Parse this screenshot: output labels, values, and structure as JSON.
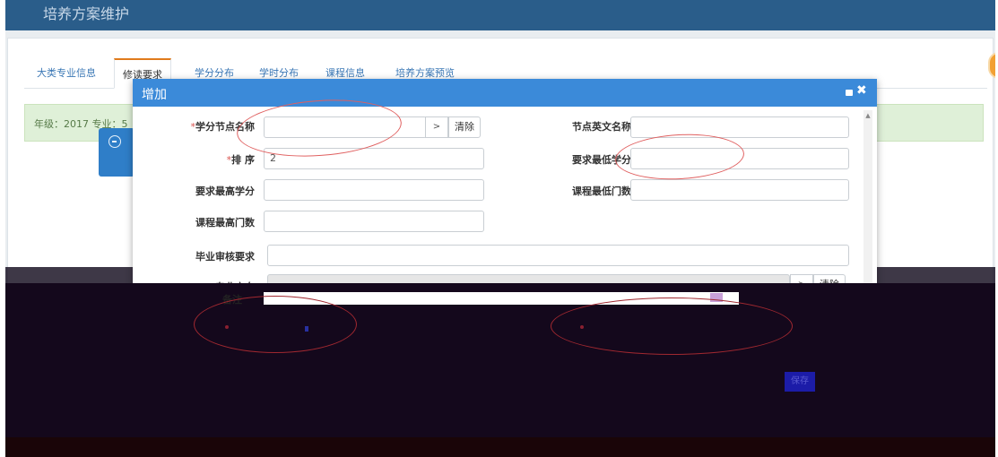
{
  "page": {
    "title": "培养方案维护"
  },
  "tabs": [
    {
      "label": "大类专业信息",
      "active": false
    },
    {
      "label": "修读要求",
      "active": true
    },
    {
      "label": "学分分布",
      "active": false
    },
    {
      "label": "学时分布",
      "active": false
    },
    {
      "label": "课程信息",
      "active": false
    },
    {
      "label": "培养方案预览",
      "active": false
    }
  ],
  "info_bar": {
    "text": "年级：2017 专业：5"
  },
  "modal": {
    "title": "增加",
    "fields": {
      "credit_node_name": {
        "label": "学分节点名称",
        "required": true,
        "value": "",
        "pick_button": ">",
        "clear_button": "清除"
      },
      "node_english_name": {
        "label": "节点英文名称",
        "value": ""
      },
      "order": {
        "label": "排 序",
        "required": true,
        "value": "2"
      },
      "min_credit": {
        "label": "要求最低学分",
        "value": ""
      },
      "max_credit": {
        "label": "要求最高学分",
        "value": ""
      },
      "min_courses": {
        "label": "课程最低门数",
        "value": ""
      },
      "max_courses": {
        "label": "课程最高门数",
        "value": ""
      },
      "graduation_review": {
        "label": "毕业审核要求",
        "value": ""
      },
      "major_direction": {
        "label": "专业方向",
        "value": "",
        "pick_button": ">",
        "clear_button": "清除"
      },
      "remarks": {
        "label": "备注"
      }
    }
  },
  "hidden_footer": {
    "save_button": "保存"
  },
  "colors": {
    "header_blue": "#3b8ad9",
    "top_bar": "#2a5d8a",
    "active_tab_accent": "#e07b1c",
    "required_mark": "#d9534f",
    "annotation_ellipse": "#e06060"
  },
  "icons": {
    "modal_close": "close-icon",
    "modal_maximize": "maximize-icon",
    "side_button": "minus-circle-icon"
  }
}
